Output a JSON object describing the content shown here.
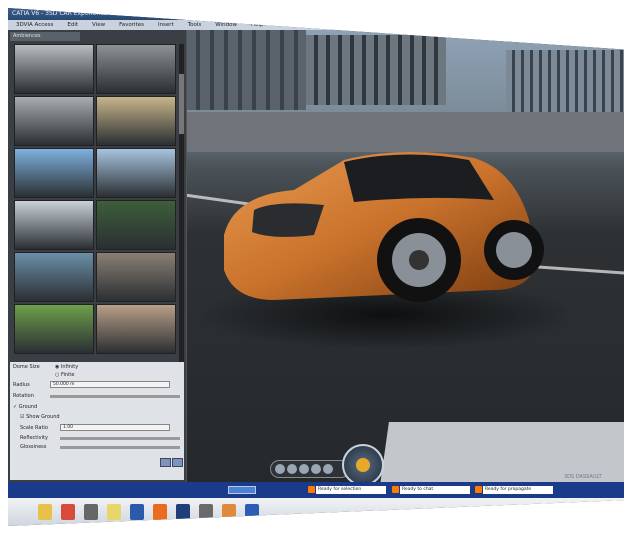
{
  "window": {
    "title": "CATIA V6 - 3SD CAR Experience - 58725724 --- IN_WORK",
    "menu": [
      "3DVIA Access",
      "Edit",
      "View",
      "Favorites",
      "Insert",
      "Tools",
      "Window",
      "Help"
    ]
  },
  "left_panel": {
    "tab_label": "Ambiences",
    "thumbnail_colors": [
      [
        "#b8bcbf",
        "#8d9194"
      ],
      [
        "#a9adb0",
        "#c8b58a"
      ],
      [
        "#7fb1e0",
        "#a6c4de"
      ],
      [
        "#c9d2d8",
        "#3d5f3a"
      ],
      [
        "#6a8fa8",
        "#8a7f74"
      ],
      [
        "#6d9f4a",
        "#b89f88"
      ]
    ],
    "properties": {
      "dome_size_label": "Dome Size",
      "infinity_label": "Infinity",
      "finite_label": "Finite",
      "radius_label": "Radius",
      "radius_value": "50.000 m",
      "rotation_label": "Rotation",
      "ground_label": "Ground",
      "show_ground_label": "Show Ground",
      "scale_ratio_label": "Scale Ratio",
      "scale_ratio_value": "1.00",
      "reflectivity_label": "Reflectivity",
      "glossiness_label": "Glossiness"
    }
  },
  "viewport": {
    "car_color": "#c9722c"
  },
  "status_bar": {
    "search_value": "",
    "field1": "Ready for selection",
    "field2": "Ready to chat",
    "field3": "Ready for propagate"
  },
  "brand_text": "3DS DASSAULT",
  "taskbar_icons": [
    "folder-icon",
    "package-icon",
    "app-icon",
    "lamp-icon",
    "catia-icon",
    "firefox-icon",
    "photoshop-icon",
    "media-icon",
    "image-icon",
    "catia2-icon"
  ]
}
